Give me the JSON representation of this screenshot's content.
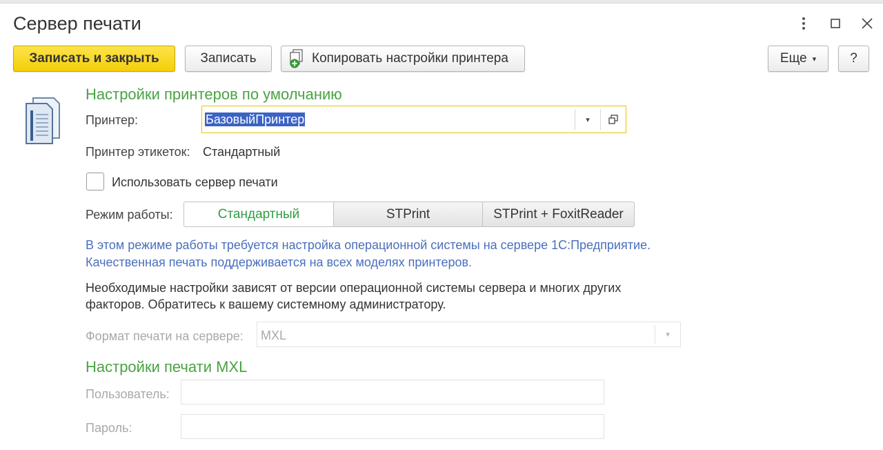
{
  "window": {
    "title": "Сервер печати",
    "more_icon": "vertical-dots-icon",
    "maximize_icon": "maximize-icon",
    "close_icon": "close-icon"
  },
  "toolbar": {
    "save_close_label": "Записать и закрыть",
    "save_label": "Записать",
    "copy_printer_label": "Копировать настройки принтера",
    "more_label": "Еще",
    "help_label": "?"
  },
  "default_printers": {
    "section_title": "Настройки принтеров по умолчанию",
    "printer_label": "Принтер:",
    "printer_value": "БазовыйПринтер",
    "label_printer_label": "Принтер этикеток:",
    "label_printer_value": "Стандартный"
  },
  "use_print_server_label": "Использовать сервер печати",
  "mode": {
    "label": "Режим работы:",
    "options": [
      "Стандартный",
      "STPrint",
      "STPrint + FoxitReader"
    ],
    "selected": "Стандартный"
  },
  "info_text": {
    "line1": "В этом режиме работы требуется настройка операционной системы на сервере 1С:Предприятие.",
    "line2": "Качественная печать поддерживается на всех моделях принтеров."
  },
  "note_text": {
    "line1": "Необходимые настройки зависят от версии операционной системы сервера и многих других",
    "line2": "факторов. Обратитесь к вашему системному администратору."
  },
  "server_format": {
    "label": "Формат печати на сервере:",
    "value": "MXL"
  },
  "mxl_settings": {
    "section_title": "Настройки печати MXL",
    "user_label": "Пользователь:",
    "user_value": "",
    "password_label": "Пароль:",
    "password_value": ""
  },
  "colors": {
    "primary_button": "#f4cf08",
    "section_title": "#4aa342",
    "info_text": "#4a6fbd",
    "focus_border": "#e8c500",
    "selection": "#3b63c4"
  }
}
